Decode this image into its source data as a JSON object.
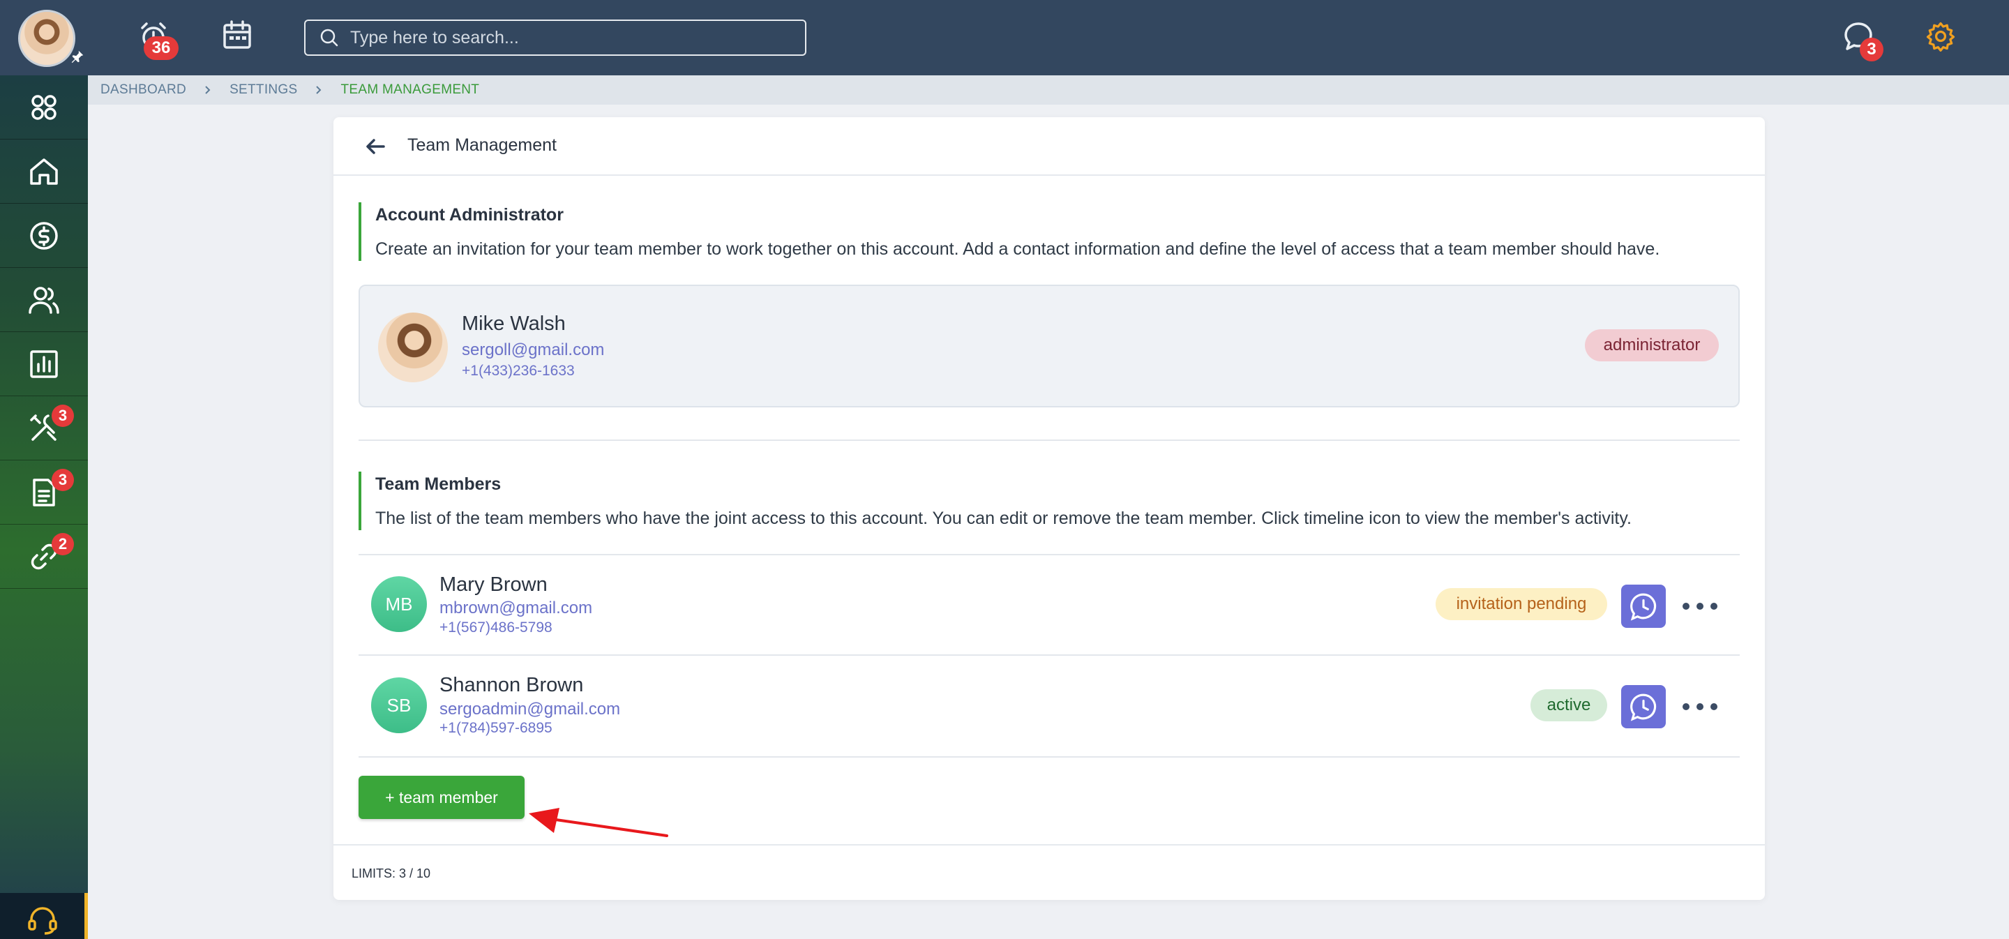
{
  "topbar": {
    "alerts_count": "36",
    "search_placeholder": "Type here to search...",
    "messages_count": "3",
    "colors": {
      "bar": "#33475f",
      "badge": "#e53a3a",
      "gear": "#f0a020"
    }
  },
  "sidebar": {
    "items": [
      {
        "icon": "apps-grid-icon",
        "badge": ""
      },
      {
        "icon": "home-icon",
        "badge": ""
      },
      {
        "icon": "dollar-icon",
        "badge": ""
      },
      {
        "icon": "users-icon",
        "badge": ""
      },
      {
        "icon": "bar-chart-icon",
        "badge": ""
      },
      {
        "icon": "tools-icon",
        "badge": "3"
      },
      {
        "icon": "document-icon",
        "badge": "3"
      },
      {
        "icon": "link-icon",
        "badge": "2"
      }
    ],
    "support_icon": "headset-icon"
  },
  "breadcrumb": {
    "items": [
      "DASHBOARD",
      "SETTINGS",
      "TEAM MANAGEMENT"
    ]
  },
  "page": {
    "title": "Team Management"
  },
  "admin_section": {
    "title": "Account Administrator",
    "description": "Create an invitation for your team member to work together on this account. Add a contact information and define the level of access that a team member should have.",
    "admin": {
      "name": "Mike Walsh",
      "email": "sergoll@gmail.com",
      "phone": "+1(433)236-1633",
      "role": "administrator"
    }
  },
  "members_section": {
    "title": "Team Members",
    "description": "The list of the team members who have the joint access to this account. You can edit or remove the team member. Click timeline icon to view the member's activity.",
    "members": [
      {
        "initials": "MB",
        "name": "Mary Brown",
        "email": "mbrown@gmail.com",
        "phone": "+1(567)486-5798",
        "status": "invitation pending"
      },
      {
        "initials": "SB",
        "name": "Shannon Brown",
        "email": "sergoadmin@gmail.com",
        "phone": "+1(784)597-6895",
        "status": "active"
      }
    ],
    "add_button": "+ team member"
  },
  "footer": {
    "limits": "LIMITS: 3 / 10"
  }
}
